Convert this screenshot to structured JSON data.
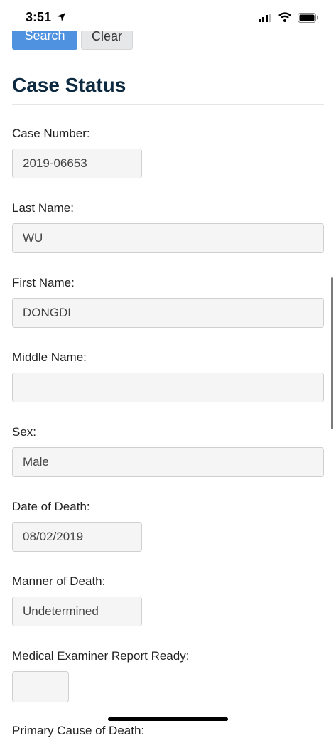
{
  "status_bar": {
    "time": "3:51"
  },
  "buttons": {
    "search": "Search",
    "clear": "Clear"
  },
  "page_title": "Case Status",
  "fields": {
    "case_number": {
      "label": "Case Number:",
      "value": "2019-06653"
    },
    "last_name": {
      "label": "Last Name:",
      "value": "WU"
    },
    "first_name": {
      "label": "First Name:",
      "value": "DONGDI"
    },
    "middle_name": {
      "label": "Middle Name:",
      "value": ""
    },
    "sex": {
      "label": "Sex:",
      "value": "Male"
    },
    "date_of_death": {
      "label": "Date of Death:",
      "value": "08/02/2019"
    },
    "manner_of_death": {
      "label": "Manner of Death:",
      "value": "Undetermined"
    },
    "me_report_ready": {
      "label": "Medical Examiner Report Ready:",
      "value": ""
    },
    "primary_cause": {
      "label": "Primary Cause of Death:"
    }
  },
  "colors": {
    "primary": "#4f92df",
    "title": "#0d2a40"
  }
}
